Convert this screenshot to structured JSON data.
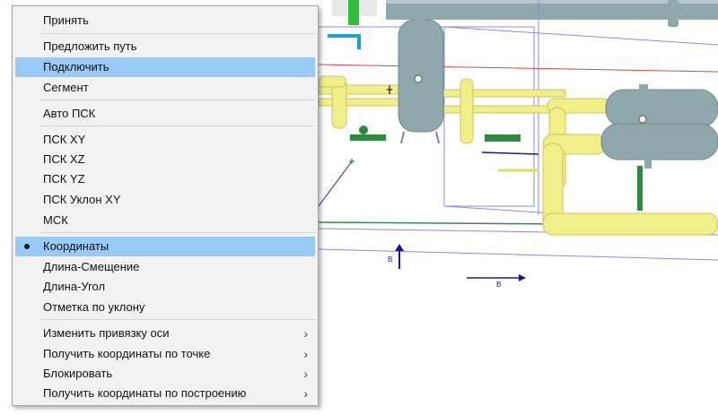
{
  "menu": {
    "items": [
      {
        "label": "Принять"
      },
      {
        "label": "Предложить путь"
      },
      {
        "label": "Подключить",
        "highlighted": true
      },
      {
        "label": "Сегмент"
      },
      {
        "label": "Авто ПСК"
      },
      {
        "label": "ПСК XY"
      },
      {
        "label": "ПСК XZ"
      },
      {
        "label": "ПСК YZ"
      },
      {
        "label": "ПСК Уклон XY"
      },
      {
        "label": "МСК"
      },
      {
        "label": "Координаты",
        "checked": true
      },
      {
        "label": "Длина-Смещение"
      },
      {
        "label": "Длина-Угол"
      },
      {
        "label": "Отметка по уклону"
      },
      {
        "label": "Изменить привязку оси",
        "submenu": true
      },
      {
        "label": "Получить координаты по точке",
        "submenu": true
      },
      {
        "label": "Блокировать",
        "submenu": true
      },
      {
        "label": "Получить координаты по построению",
        "submenu": true
      }
    ],
    "submenu_arrow": "›"
  },
  "scene": {
    "label_b1": "B",
    "label_b2": "B"
  },
  "colors": {
    "pipe_yellow": "#f2ef8a",
    "vessel": "#8fa8ac",
    "highlight": "#99c9f5",
    "menu_bg": "#f2f2f2"
  }
}
